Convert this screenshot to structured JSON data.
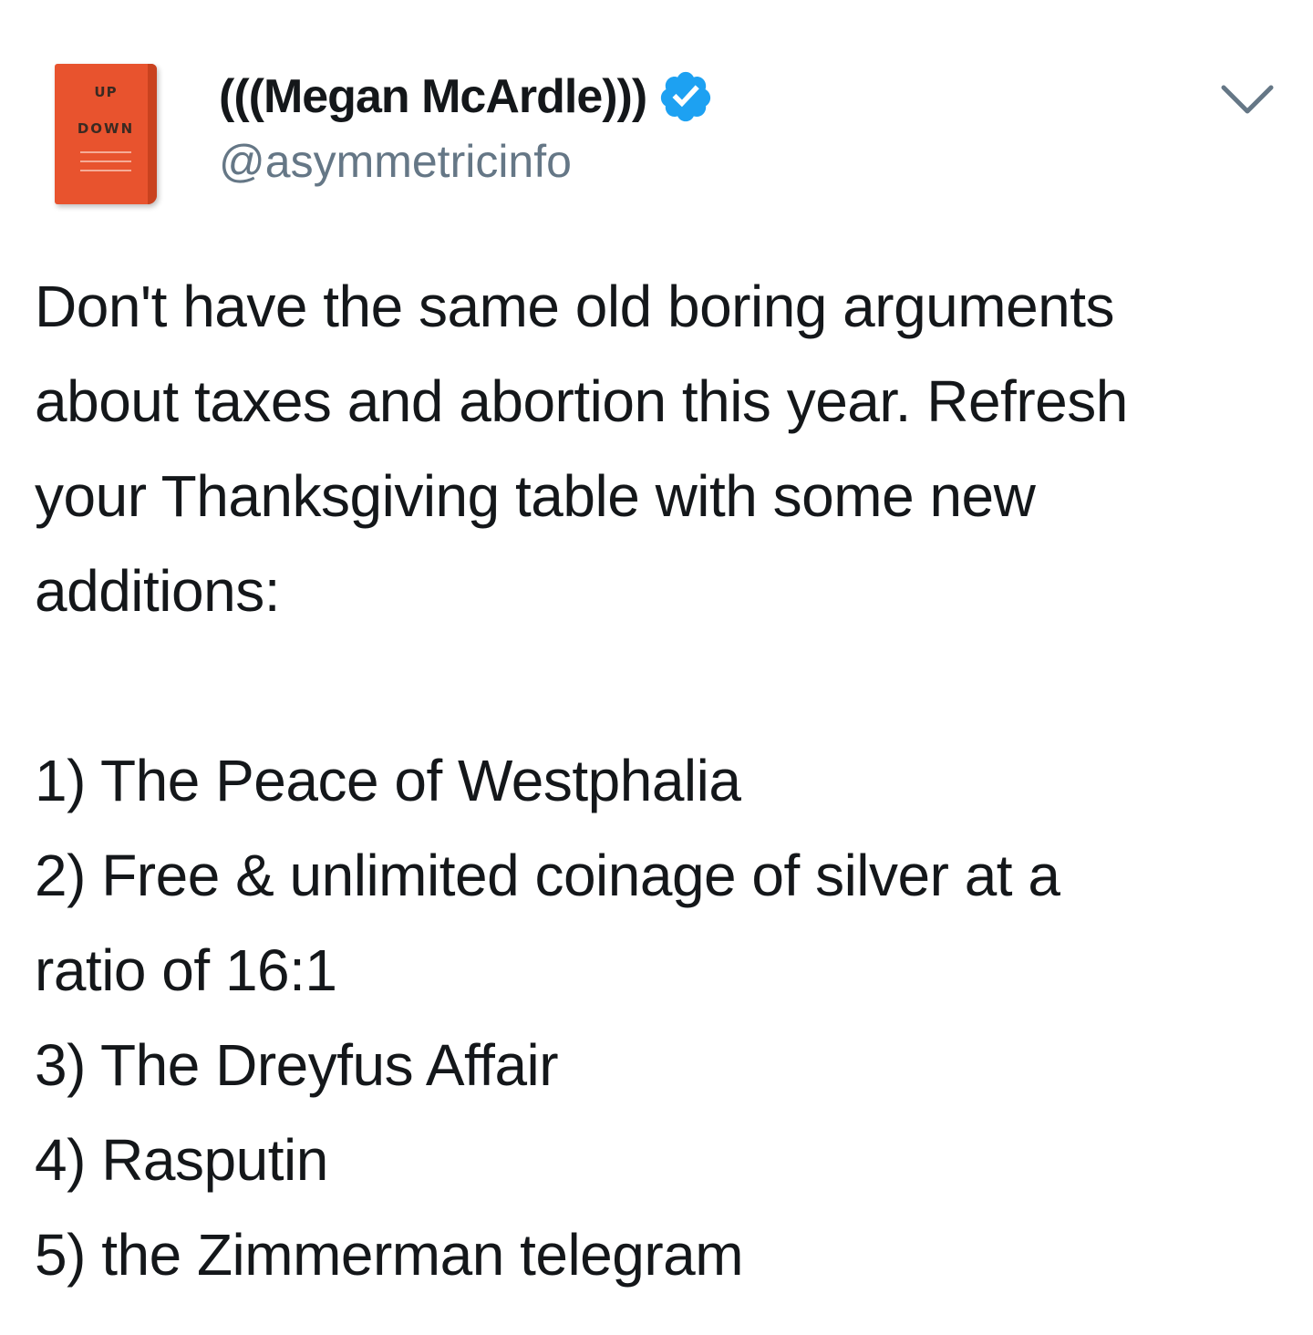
{
  "tweet": {
    "author": {
      "display_name": "(((Megan McArdle)))",
      "handle": "@asymmetricinfo",
      "verified": true,
      "avatar": {
        "icon": "book-cover-avatar-icon",
        "title_top": "UP",
        "title_bottom": "DOWN",
        "color": "#e8532e"
      }
    },
    "menu_icon": "chevron-down-icon",
    "intro_lines": [
      "Don't have the same old boring arguments",
      "about taxes and abortion this year. Refresh",
      "your Thanksgiving table with some new",
      "additions:"
    ],
    "list_lines": [
      "1) The Peace of Westphalia",
      "2) Free & unlimited coinage of silver at a",
      "ratio of 16:1",
      "3) The Dreyfus Affair",
      "4) Rasputin",
      "5) the Zimmerman telegram"
    ],
    "colors": {
      "text": "#14171a",
      "handle": "#657786",
      "verified_badge": "#1da1f2",
      "chevron": "#657786"
    }
  }
}
